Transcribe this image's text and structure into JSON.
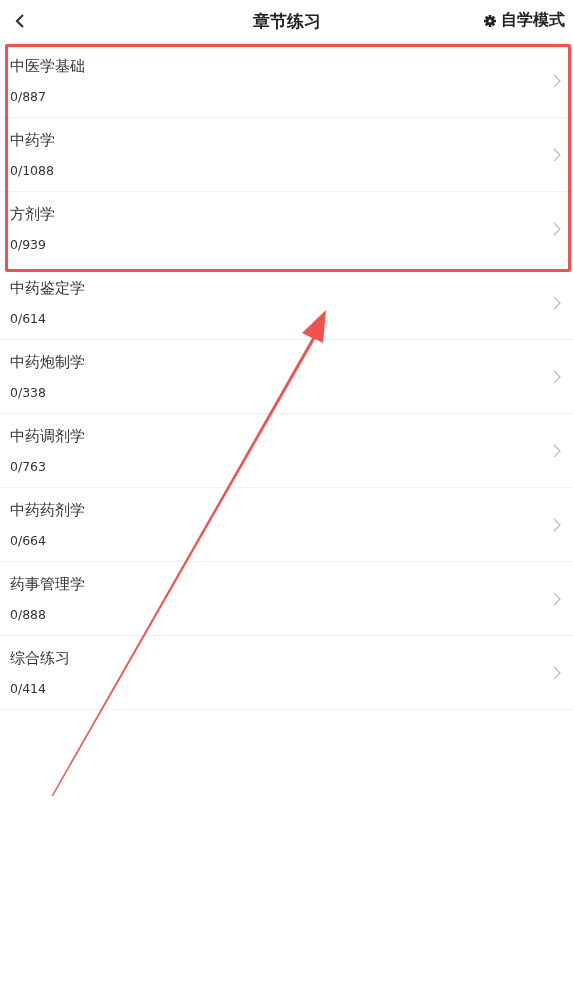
{
  "header": {
    "title": "章节练习",
    "mode_button": "自学模式"
  },
  "chapters": [
    {
      "name": "中医学基础",
      "progress": "0/887",
      "highlighted": true
    },
    {
      "name": "中药学",
      "progress": "0/1088",
      "highlighted": true
    },
    {
      "name": "方剂学",
      "progress": "0/939",
      "highlighted": true
    },
    {
      "name": "中药鉴定学",
      "progress": "0/614",
      "highlighted": false
    },
    {
      "name": "中药炮制学",
      "progress": "0/338",
      "highlighted": false
    },
    {
      "name": "中药调剂学",
      "progress": "0/763",
      "highlighted": false
    },
    {
      "name": "中药药剂学",
      "progress": "0/664",
      "highlighted": false
    },
    {
      "name": "药事管理学",
      "progress": "0/888",
      "highlighted": false
    },
    {
      "name": "综合练习",
      "progress": "0/414",
      "highlighted": false
    }
  ]
}
